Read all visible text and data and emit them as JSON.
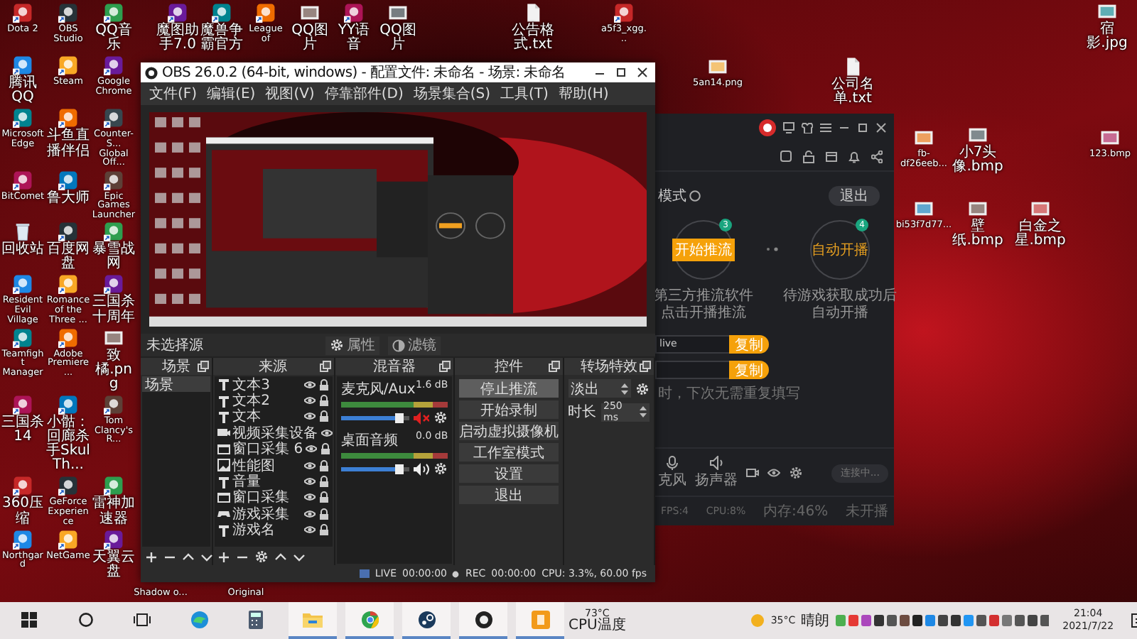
{
  "desktop": {
    "grid_icons": [
      {
        "label": "Dota 2",
        "kind": "app"
      },
      {
        "label": "OBS Studio",
        "kind": "app"
      },
      {
        "label": "QQ音乐",
        "kind": "app"
      },
      {
        "label": "腾讯QQ",
        "kind": "app"
      },
      {
        "label": "Steam",
        "kind": "app"
      },
      {
        "label": "Google Chrome",
        "kind": "app"
      },
      {
        "label": "Microsoft Edge",
        "kind": "app"
      },
      {
        "label": "斗鱼直播伴侣",
        "kind": "app"
      },
      {
        "label": "Counter-S... Global Off...",
        "kind": "app"
      },
      {
        "label": "BitComet",
        "kind": "app"
      },
      {
        "label": "鲁大师",
        "kind": "app"
      },
      {
        "label": "Epic Games Launcher",
        "kind": "app"
      },
      {
        "label": "回收站",
        "kind": "recycle-bin"
      },
      {
        "label": "百度网盘",
        "kind": "app"
      },
      {
        "label": "暴雪战网",
        "kind": "app"
      },
      {
        "label": "Resident Evil Village",
        "kind": "app"
      },
      {
        "label": "Romance of the Three ...",
        "kind": "app"
      },
      {
        "label": "三国杀十周年",
        "kind": "app"
      },
      {
        "label": "Teamfight Manager",
        "kind": "app"
      },
      {
        "label": "Adobe Premiere ...",
        "kind": "app"
      },
      {
        "label": "致橘.png",
        "kind": "image"
      },
      {
        "label": "三国杀14",
        "kind": "app"
      },
      {
        "label": "小骷：回廊杀手Skul Th...",
        "kind": "app"
      },
      {
        "label": "Tom Clancy's R...",
        "kind": "app"
      },
      {
        "label": "360压缩",
        "kind": "app"
      },
      {
        "label": "GeForce Experience",
        "kind": "app"
      },
      {
        "label": "雷神加速器",
        "kind": "app"
      },
      {
        "label": "Northgard",
        "kind": "app"
      },
      {
        "label": "NetGame",
        "kind": "app"
      },
      {
        "label": "天翼云盘",
        "kind": "app"
      }
    ],
    "scattered_icons": [
      {
        "label": "魔图助手7.0",
        "kind": "app"
      },
      {
        "label": "魔兽争霸官方",
        "kind": "app"
      },
      {
        "label": "League of",
        "kind": "app"
      },
      {
        "label": "QQ图片",
        "kind": "image"
      },
      {
        "label": "YY语音",
        "kind": "app"
      },
      {
        "label": "QQ图片",
        "kind": "image"
      },
      {
        "label": "公告格式.txt",
        "kind": "document"
      },
      {
        "label": "a5f3_xgg...",
        "kind": "app"
      },
      {
        "label": "5an14.png",
        "kind": "image"
      },
      {
        "label": "公司名单.txt",
        "kind": "document"
      },
      {
        "label": "宿影.jpg",
        "kind": "image"
      },
      {
        "label": "fb-df26eeb...",
        "kind": "image"
      },
      {
        "label": "小7头像.bmp",
        "kind": "image"
      },
      {
        "label": "123.bmp",
        "kind": "image"
      },
      {
        "label": "bi53f7d77...",
        "kind": "image"
      },
      {
        "label": "壁纸.bmp",
        "kind": "image"
      },
      {
        "label": "白金之星.bmp",
        "kind": "image"
      },
      {
        "label": "Shadow o...",
        "kind": "none"
      },
      {
        "label": "Original",
        "kind": "none"
      }
    ]
  },
  "obs_window": {
    "title": "OBS 26.0.2 (64-bit, windows) - 配置文件: 未命名 - 场景: 未命名",
    "menu": [
      "文件(F)",
      "编辑(E)",
      "视图(V)",
      "停靠部件(D)",
      "场景集合(S)",
      "工具(T)",
      "帮助(H)"
    ],
    "source_bar": {
      "label": "未选择源",
      "properties": "属性",
      "filters": "滤镜"
    },
    "scenes": {
      "title": "场景",
      "items": [
        {
          "label": "场景",
          "selected": true
        }
      ]
    },
    "sources": {
      "title": "来源",
      "items": [
        {
          "label": "文本3",
          "kind": "text"
        },
        {
          "label": "文本2",
          "kind": "text"
        },
        {
          "label": "文本",
          "kind": "text"
        },
        {
          "label": "视频采集设备",
          "kind": "camera"
        },
        {
          "label": "窗口采集 6",
          "kind": "window"
        },
        {
          "label": "性能图",
          "kind": "image"
        },
        {
          "label": "音量",
          "kind": "text"
        },
        {
          "label": "窗口采集",
          "kind": "window"
        },
        {
          "label": "游戏采集",
          "kind": "game"
        },
        {
          "label": "游戏名",
          "kind": "text"
        }
      ]
    },
    "mixer": {
      "title": "混音器",
      "channels": [
        {
          "name": "麦克风/Aux",
          "reading": "1.6 dB",
          "level": 0.85,
          "muted": true
        },
        {
          "name": "桌面音频",
          "reading": "0.0 dB",
          "level": 0.85,
          "muted": false
        }
      ]
    },
    "controls": {
      "title": "控件",
      "buttons": [
        {
          "label": "停止推流",
          "active": true
        },
        {
          "label": "开始录制",
          "active": false
        },
        {
          "label": "启动虚拟摄像机",
          "active": false
        },
        {
          "label": "工作室模式",
          "active": false
        },
        {
          "label": "设置",
          "active": false
        },
        {
          "label": "退出",
          "active": false
        }
      ]
    },
    "transitions": {
      "title": "转场特效",
      "type": "淡出",
      "duration_label": "时长",
      "duration": "250 ms"
    },
    "status_bar": {
      "live": "LIVE",
      "live_time": "00:00:00",
      "rec": "REC",
      "rec_time": "00:00:00",
      "performance": "CPU: 3.3%, 60.00 fps"
    }
  },
  "stream_window": {
    "mode_label": "模式",
    "exit_button": "退出",
    "steps": [
      {
        "badge": "3",
        "kind": "button",
        "action": "开始推流",
        "caption_lines": [
          "第三方推流软件",
          "点击开播推流"
        ]
      },
      {
        "badge": "4",
        "kind": "text",
        "action": "自动开播",
        "caption_lines": [
          "待游戏获取成功后",
          "自动开播"
        ]
      }
    ],
    "fields": [
      {
        "value": "live",
        "button": "复制"
      },
      {
        "button": "复制"
      }
    ],
    "hint": "时，下次无需重复填写",
    "mic_label": "克风",
    "speaker_label": "扬声器",
    "connect_button": "连接中...",
    "status": [
      "FPS:4",
      "CPU:8%",
      "内存:46%",
      "未开播"
    ]
  },
  "taskbar": {
    "apps": [
      {
        "kind": "start",
        "running": false
      },
      {
        "kind": "search",
        "running": false
      },
      {
        "kind": "task-view",
        "running": false
      },
      {
        "kind": "edge",
        "running": false
      },
      {
        "kind": "calculator",
        "running": false
      },
      {
        "kind": "explorer",
        "running": true
      },
      {
        "kind": "chrome",
        "running": true
      },
      {
        "kind": "steam",
        "running": true
      },
      {
        "kind": "obs",
        "running": true
      },
      {
        "kind": "app",
        "running": true
      }
    ],
    "cpu_temp": "73°C",
    "cpu_label": "CPU温度",
    "temperature": "35°C",
    "weather": "晴朗",
    "time": "21:04",
    "date": "2021/7/22"
  }
}
